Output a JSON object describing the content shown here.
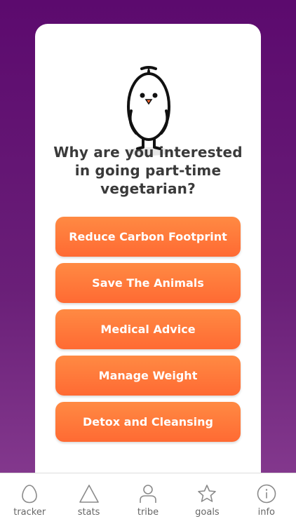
{
  "question": "Why are you interested in going part-time vegetarian?",
  "options": [
    {
      "label": "Reduce Carbon Footprint"
    },
    {
      "label": "Save The Animals"
    },
    {
      "label": "Medical Advice"
    },
    {
      "label": "Manage Weight"
    },
    {
      "label": "Detox and Cleansing"
    }
  ],
  "tabbar": {
    "tabs": [
      {
        "label": "tracker",
        "icon": "egg-icon"
      },
      {
        "label": "stats",
        "icon": "triangle-icon"
      },
      {
        "label": "tribe",
        "icon": "person-icon"
      },
      {
        "label": "goals",
        "icon": "star-icon"
      },
      {
        "label": "info",
        "icon": "info-icon"
      }
    ]
  },
  "colors": {
    "background_top": "#5c0a6e",
    "background_bottom": "#8a3f93",
    "button": "#ff7a3c",
    "question_text": "#3a3a3a"
  }
}
